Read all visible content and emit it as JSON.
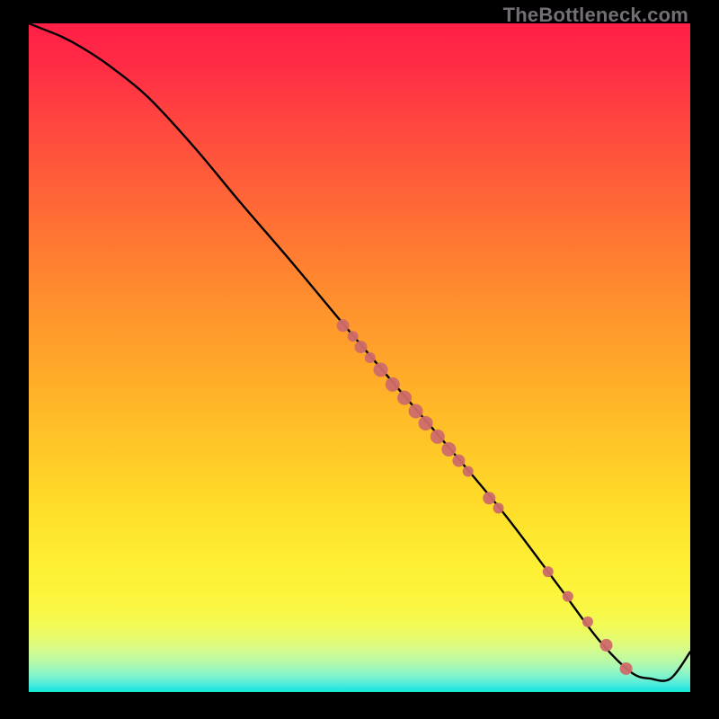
{
  "watermark": "TheBottleneck.com",
  "colors": {
    "pageBg": "#000000",
    "curve": "#000000",
    "marker": "#cd6b69",
    "markerStroke": "#cd6b69",
    "watermark": "#736f74"
  },
  "chart_data": {
    "type": "line",
    "title": "",
    "xlabel": "",
    "ylabel": "",
    "xlim": [
      0,
      100
    ],
    "ylim": [
      0,
      100
    ],
    "series": [
      {
        "name": "bottleneck-curve",
        "x": [
          0,
          2,
          5,
          8,
          12,
          18,
          25,
          32,
          40,
          48,
          56,
          64,
          72,
          80,
          86,
          91,
          94,
          97,
          100
        ],
        "y": [
          100,
          99.2,
          98.0,
          96.4,
          93.8,
          89.0,
          81.5,
          73.2,
          64.0,
          54.5,
          45.2,
          36.0,
          26.5,
          16.0,
          8.0,
          3.0,
          2.0,
          2.0,
          6.0
        ]
      }
    ],
    "markers": {
      "name": "highlighted-range",
      "points": [
        {
          "x": 47.5,
          "y": 54.8,
          "r": 7
        },
        {
          "x": 49.0,
          "y": 53.2,
          "r": 6
        },
        {
          "x": 50.2,
          "y": 51.6,
          "r": 7
        },
        {
          "x": 51.6,
          "y": 50.0,
          "r": 6
        },
        {
          "x": 53.2,
          "y": 48.2,
          "r": 8
        },
        {
          "x": 55.0,
          "y": 46.0,
          "r": 8
        },
        {
          "x": 56.8,
          "y": 44.0,
          "r": 8
        },
        {
          "x": 58.5,
          "y": 42.0,
          "r": 8
        },
        {
          "x": 60.0,
          "y": 40.2,
          "r": 8
        },
        {
          "x": 61.8,
          "y": 38.2,
          "r": 8
        },
        {
          "x": 63.5,
          "y": 36.3,
          "r": 8
        },
        {
          "x": 65.0,
          "y": 34.6,
          "r": 7
        },
        {
          "x": 66.4,
          "y": 33.0,
          "r": 6
        },
        {
          "x": 69.6,
          "y": 29.0,
          "r": 7
        },
        {
          "x": 71.0,
          "y": 27.5,
          "r": 6
        },
        {
          "x": 78.5,
          "y": 18.0,
          "r": 6
        },
        {
          "x": 81.5,
          "y": 14.3,
          "r": 6
        },
        {
          "x": 84.5,
          "y": 10.5,
          "r": 6
        },
        {
          "x": 87.3,
          "y": 7.0,
          "r": 7
        },
        {
          "x": 90.3,
          "y": 3.5,
          "r": 7
        }
      ]
    }
  }
}
